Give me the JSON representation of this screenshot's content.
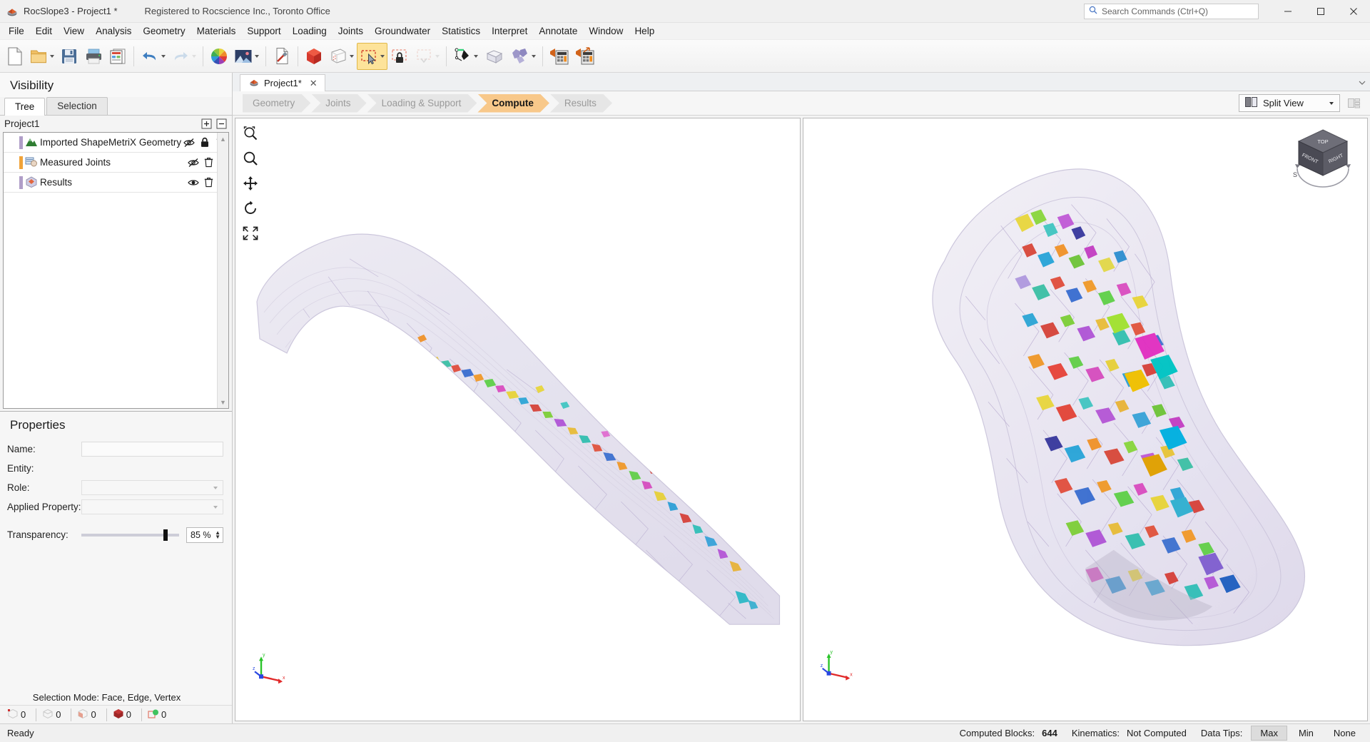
{
  "window": {
    "title": "RocSlope3 - Project1 *",
    "registration": "Registered to Rocscience Inc., Toronto Office",
    "app_icon": "rocslope-icon",
    "minimize": "–",
    "maximize": "□",
    "close": "✕"
  },
  "search": {
    "placeholder": "Search Commands (Ctrl+Q)",
    "icon": "search-icon"
  },
  "menu": {
    "items": [
      "File",
      "Edit",
      "View",
      "Analysis",
      "Geometry",
      "Materials",
      "Support",
      "Loading",
      "Joints",
      "Groundwater",
      "Statistics",
      "Interpret",
      "Annotate",
      "Window",
      "Help"
    ]
  },
  "toolbar": {
    "groups": [
      {
        "buttons": [
          {
            "name": "new-file",
            "icon": "page-icon",
            "state": "normal",
            "dropdown": false
          },
          {
            "name": "open-file",
            "icon": "folder-icon",
            "state": "normal",
            "dropdown": true
          },
          {
            "name": "save-file",
            "icon": "floppy-icon",
            "state": "normal",
            "dropdown": false
          },
          {
            "name": "print",
            "icon": "printer-icon",
            "state": "normal",
            "dropdown": false
          },
          {
            "name": "report",
            "icon": "report-icon",
            "state": "normal",
            "dropdown": false
          }
        ]
      },
      {
        "buttons": [
          {
            "name": "undo",
            "icon": "undo-arrow-icon",
            "state": "normal",
            "dropdown": true
          },
          {
            "name": "redo",
            "icon": "redo-arrow-icon",
            "state": "disabled",
            "dropdown": true
          }
        ]
      },
      {
        "buttons": [
          {
            "name": "color-wheel",
            "icon": "color-wheel-icon",
            "state": "normal",
            "dropdown": false
          },
          {
            "name": "image-export",
            "icon": "image-icon",
            "state": "normal",
            "dropdown": true
          }
        ]
      },
      {
        "buttons": [
          {
            "name": "measure-tool",
            "icon": "measure-pen-icon",
            "state": "normal",
            "dropdown": false
          }
        ]
      },
      {
        "buttons": [
          {
            "name": "solid-view",
            "icon": "red-solid-icon",
            "state": "normal",
            "dropdown": false
          },
          {
            "name": "wireframe-view",
            "icon": "wireframe-box-icon",
            "state": "normal",
            "dropdown": true
          },
          {
            "name": "select-box",
            "icon": "select-rect-cursor-icon",
            "state": "active",
            "dropdown": true
          },
          {
            "name": "lock-selection",
            "icon": "lock-rect-icon",
            "state": "normal",
            "dropdown": false
          },
          {
            "name": "clear-selection",
            "icon": "dashed-rect-icon",
            "state": "disabled",
            "dropdown": true
          }
        ]
      },
      {
        "buttons": [
          {
            "name": "draw-joint",
            "icon": "pen-node-icon",
            "state": "normal",
            "dropdown": true
          },
          {
            "name": "excavation-box",
            "icon": "open-box-icon",
            "state": "normal",
            "dropdown": false
          },
          {
            "name": "block-tool",
            "icon": "purple-blocks-icon",
            "state": "normal",
            "dropdown": true
          }
        ]
      },
      {
        "buttons": [
          {
            "name": "compute",
            "icon": "compute-icon",
            "state": "normal",
            "dropdown": false
          },
          {
            "name": "compute-export",
            "icon": "compute-export-icon",
            "state": "normal",
            "dropdown": false
          }
        ]
      }
    ]
  },
  "visibility": {
    "panel_title": "Visibility",
    "tabs": [
      {
        "label": "Tree",
        "selected": true
      },
      {
        "label": "Selection",
        "selected": false
      }
    ],
    "project_label": "Project1",
    "expand_icon": "expand-all-icon",
    "collapse_icon": "collapse-all-icon",
    "tree_items": [
      {
        "label": "Imported ShapeMetriX Geometry",
        "icon": "mountain-icon",
        "visibility_icon": "eye-hidden-icon",
        "locked": true,
        "lock_icon": "lock-icon",
        "delete_icon": "trash-icon",
        "bar_color": "#b09ec8"
      },
      {
        "label": "Measured Joints",
        "icon": "joints-icon",
        "visibility_icon": "eye-hidden-icon",
        "locked": false,
        "delete_icon": "trash-icon",
        "bar_color": "#f0a33a"
      },
      {
        "label": "Results",
        "icon": "results-icon",
        "visibility_icon": "eye-visible-icon",
        "locked": false,
        "delete_icon": "trash-icon",
        "bar_color": "#b09ec8"
      }
    ]
  },
  "properties": {
    "panel_title": "Properties",
    "fields": [
      {
        "label": "Name:",
        "type": "text",
        "value": ""
      },
      {
        "label": "Entity:",
        "type": "static",
        "value": ""
      },
      {
        "label": "Role:",
        "type": "combo",
        "value": ""
      },
      {
        "label": "Applied Property:",
        "type": "combo",
        "value": ""
      }
    ],
    "transparency": {
      "label": "Transparency:",
      "value": "85 %",
      "percent": 85
    }
  },
  "selection_status": {
    "mode_text": "Selection Mode: Face, Edge, Vertex",
    "counts": [
      {
        "icon": "vertex-count-icon",
        "value": "0"
      },
      {
        "icon": "edge-count-icon",
        "value": "0"
      },
      {
        "icon": "face-count-icon",
        "value": "0"
      },
      {
        "icon": "block-count-icon",
        "value": "0"
      },
      {
        "icon": "joint-count-icon",
        "value": "0"
      }
    ]
  },
  "document_tabs": {
    "tabs": [
      {
        "label": "Project1*",
        "icon": "rocslope-icon",
        "close": "✕",
        "active": true
      }
    ],
    "overflow_icon": "chevron-down-icon"
  },
  "workflow": {
    "steps": [
      {
        "label": "Geometry",
        "state": "done"
      },
      {
        "label": "Joints",
        "state": "done"
      },
      {
        "label": "Loading & Support",
        "state": "done"
      },
      {
        "label": "Compute",
        "state": "current"
      },
      {
        "label": "Results",
        "state": "done"
      }
    ],
    "view_mode": {
      "label": "Split View",
      "icon": "split-view-icon",
      "caret": "chevron-down-icon"
    },
    "layout_button_icon": "view-layout-icon"
  },
  "viewports": [
    {
      "name": "left-viewport",
      "model_view": "oblique",
      "tools": [
        {
          "name": "zoom-window-tool",
          "icon": "zoom-window-icon"
        },
        {
          "name": "zoom-tool",
          "icon": "magnifier-icon"
        },
        {
          "name": "pan-tool",
          "icon": "pan-arrows-icon"
        },
        {
          "name": "rotate-tool",
          "icon": "rotate-icon"
        },
        {
          "name": "zoom-all-tool",
          "icon": "zoom-all-icon"
        }
      ],
      "axis_labels": {
        "x": "x",
        "y": "y",
        "z": "z"
      },
      "has_navcube": false
    },
    {
      "name": "right-viewport",
      "model_view": "top",
      "tools": [],
      "axis_labels": {
        "x": "x",
        "y": "y",
        "z": "z"
      },
      "has_navcube": true,
      "navcube": {
        "top": "TOP",
        "front": "FRONT",
        "right": "RIGHT",
        "compass": "S"
      }
    }
  ],
  "statusbar": {
    "ready_text": "Ready",
    "computed_blocks_label": "Computed Blocks:",
    "computed_blocks_value": "644",
    "kinematics_label": "Kinematics:",
    "kinematics_value": "Not Computed",
    "datatips_label": "Data Tips:",
    "datatips_options": [
      {
        "label": "Max",
        "selected": true
      },
      {
        "label": "Min",
        "selected": false
      },
      {
        "label": "None",
        "selected": false
      }
    ]
  },
  "colors": {
    "accent_orange": "#f8c88a",
    "toolbar_active": "#fde39a",
    "model_fill": "#e9e5f2",
    "panel_bg": "#f4f4f4"
  }
}
